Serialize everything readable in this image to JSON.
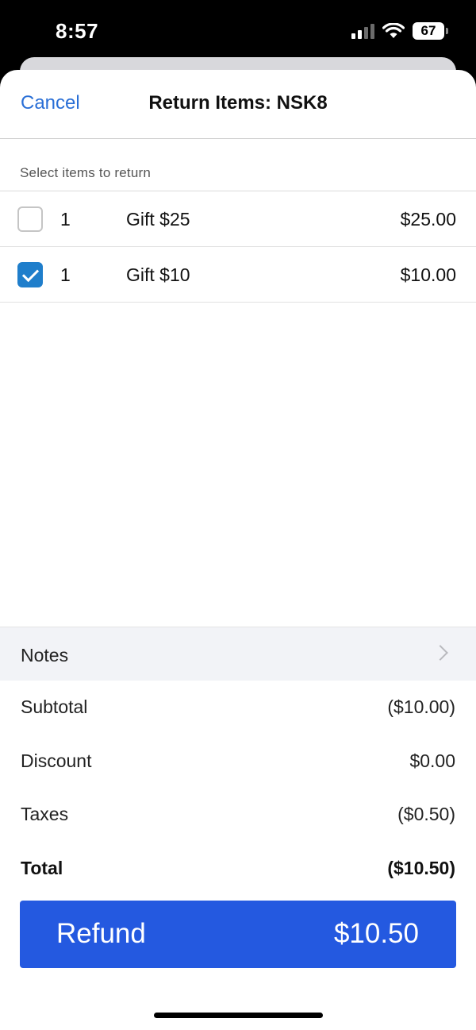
{
  "status_bar": {
    "time": "8:57",
    "battery": "67",
    "icons": [
      "cellular-signal-icon",
      "wifi-icon",
      "battery-icon"
    ]
  },
  "nav": {
    "cancel_label": "Cancel",
    "title": "Return Items: NSK8"
  },
  "section_header": "Select items to return",
  "items": [
    {
      "qty": "1",
      "name": "Gift $25",
      "price": "$25.00",
      "selected": false
    },
    {
      "qty": "1",
      "name": "Gift $10",
      "price": "$10.00",
      "selected": true
    }
  ],
  "notes_label": "Notes",
  "summary": {
    "subtotal_label": "Subtotal",
    "subtotal_value": "($10.00)",
    "discount_label": "Discount",
    "discount_value": "$0.00",
    "taxes_label": "Taxes",
    "taxes_value": "($0.50)",
    "total_label": "Total",
    "total_value": "($10.50)"
  },
  "refund_button": {
    "label": "Refund",
    "amount": "$10.50"
  },
  "colors": {
    "accent": "#2a6fd6",
    "checkbox_checked": "#1f7ecb",
    "refund_button": "#2459e0"
  }
}
